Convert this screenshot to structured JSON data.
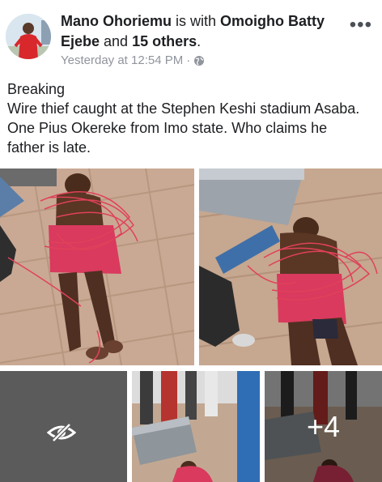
{
  "post": {
    "author": "Mano Ohoriemu",
    "with_text": " is with ",
    "tagged": "Omoigho Batty Ejebe",
    "and_text": " and ",
    "others": "15 others",
    "period": ".",
    "timestamp": "Yesterday at 12:54 PM",
    "separator": "·",
    "more_icon": "ellipsis-icon",
    "privacy_icon": "globe-icon"
  },
  "body": {
    "lines": [
      "Breaking",
      "Wire thief caught at the Stephen Keshi stadium Asaba.",
      "One Pius Okereke from Imo state. Who claims he",
      "father is late."
    ]
  },
  "photos": {
    "more_count": "+4",
    "hidden_icon": "eye-slash-icon"
  },
  "colors": {
    "text": "#1c1e21",
    "meta": "#90949c",
    "wire": "#e0415a"
  }
}
